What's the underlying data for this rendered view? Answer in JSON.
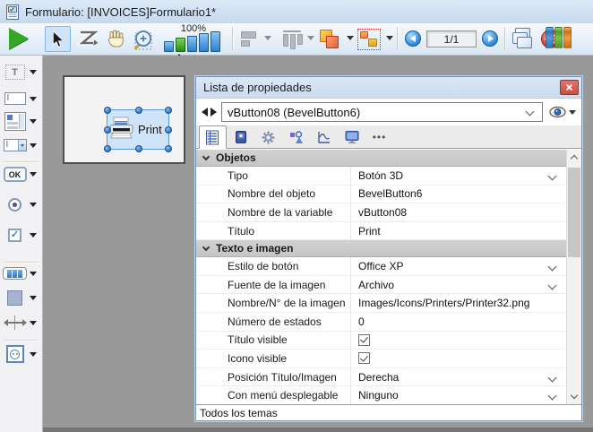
{
  "window": {
    "title": "Formulario: [INVOICES]Formulario1*"
  },
  "toolbar": {
    "zoom_level": "100%",
    "page_indicator": "1/1",
    "buttons": [
      "execute-form",
      "select-tool",
      "entry-order-tool",
      "pan-tool",
      "zoom-tool",
      "zoom-bars",
      "align",
      "distribute",
      "level-objects",
      "group-objects",
      "previous-page",
      "next-page",
      "display-pages",
      "action-menu",
      "explorer-books"
    ]
  },
  "sidebar": {
    "text_tool_glyph": "T",
    "input_tool_glyph": "I",
    "combo_tool_glyph": "I",
    "ok_button_glyph": "OK",
    "check_glyph": "✓",
    "tools": [
      "text",
      "input",
      "list-box",
      "combo-box",
      "button",
      "radio-button",
      "check-box",
      "button-grid",
      "rectangle",
      "splitter",
      "plugin-area"
    ]
  },
  "canvas": {
    "selected_button_title": "Print"
  },
  "property_list": {
    "title": "Lista de propiedades",
    "selected_object": "vButton08 (BevelButton6)",
    "sections": [
      {
        "title": "Objetos",
        "rows": [
          {
            "label": "Tipo",
            "value": "Botón 3D",
            "control": "dropdown"
          },
          {
            "label": "Nombre del objeto",
            "value": "BevelButton6",
            "control": "text"
          },
          {
            "label": "Nombre de la variable",
            "value": "vButton08",
            "control": "text"
          },
          {
            "label": "Título",
            "value": "Print",
            "control": "text"
          }
        ]
      },
      {
        "title": "Texto e imagen",
        "rows": [
          {
            "label": "Estilo de botón",
            "value": "Office XP",
            "control": "dropdown"
          },
          {
            "label": "Fuente de la imagen",
            "value": "Archivo",
            "control": "dropdown"
          },
          {
            "label": "Nombre/N° de la imagen",
            "value": "Images/Icons/Printers/Printer32.png",
            "control": "text"
          },
          {
            "label": "Número de estados",
            "value": "0",
            "control": "text"
          },
          {
            "label": "Título visible",
            "value": "checked",
            "control": "checkbox"
          },
          {
            "label": "Icono visible",
            "value": "checked",
            "control": "checkbox"
          },
          {
            "label": "Posición Título/Imagen",
            "value": "Derecha",
            "control": "dropdown"
          },
          {
            "label": "Con menú desplegable",
            "value": "Ninguno",
            "control": "dropdown"
          }
        ]
      }
    ],
    "status_bar": "Todos los temas"
  },
  "colors": {
    "titlebar": "#cfdff1",
    "toolbar_selection": "#cfe4f8",
    "canvas": "#999999",
    "selection_handle": "#2a6fc0",
    "selected_button_fill": "#cfe4f8",
    "close_button": "#c94f3f",
    "zoom_active_green": "#3aa028"
  }
}
